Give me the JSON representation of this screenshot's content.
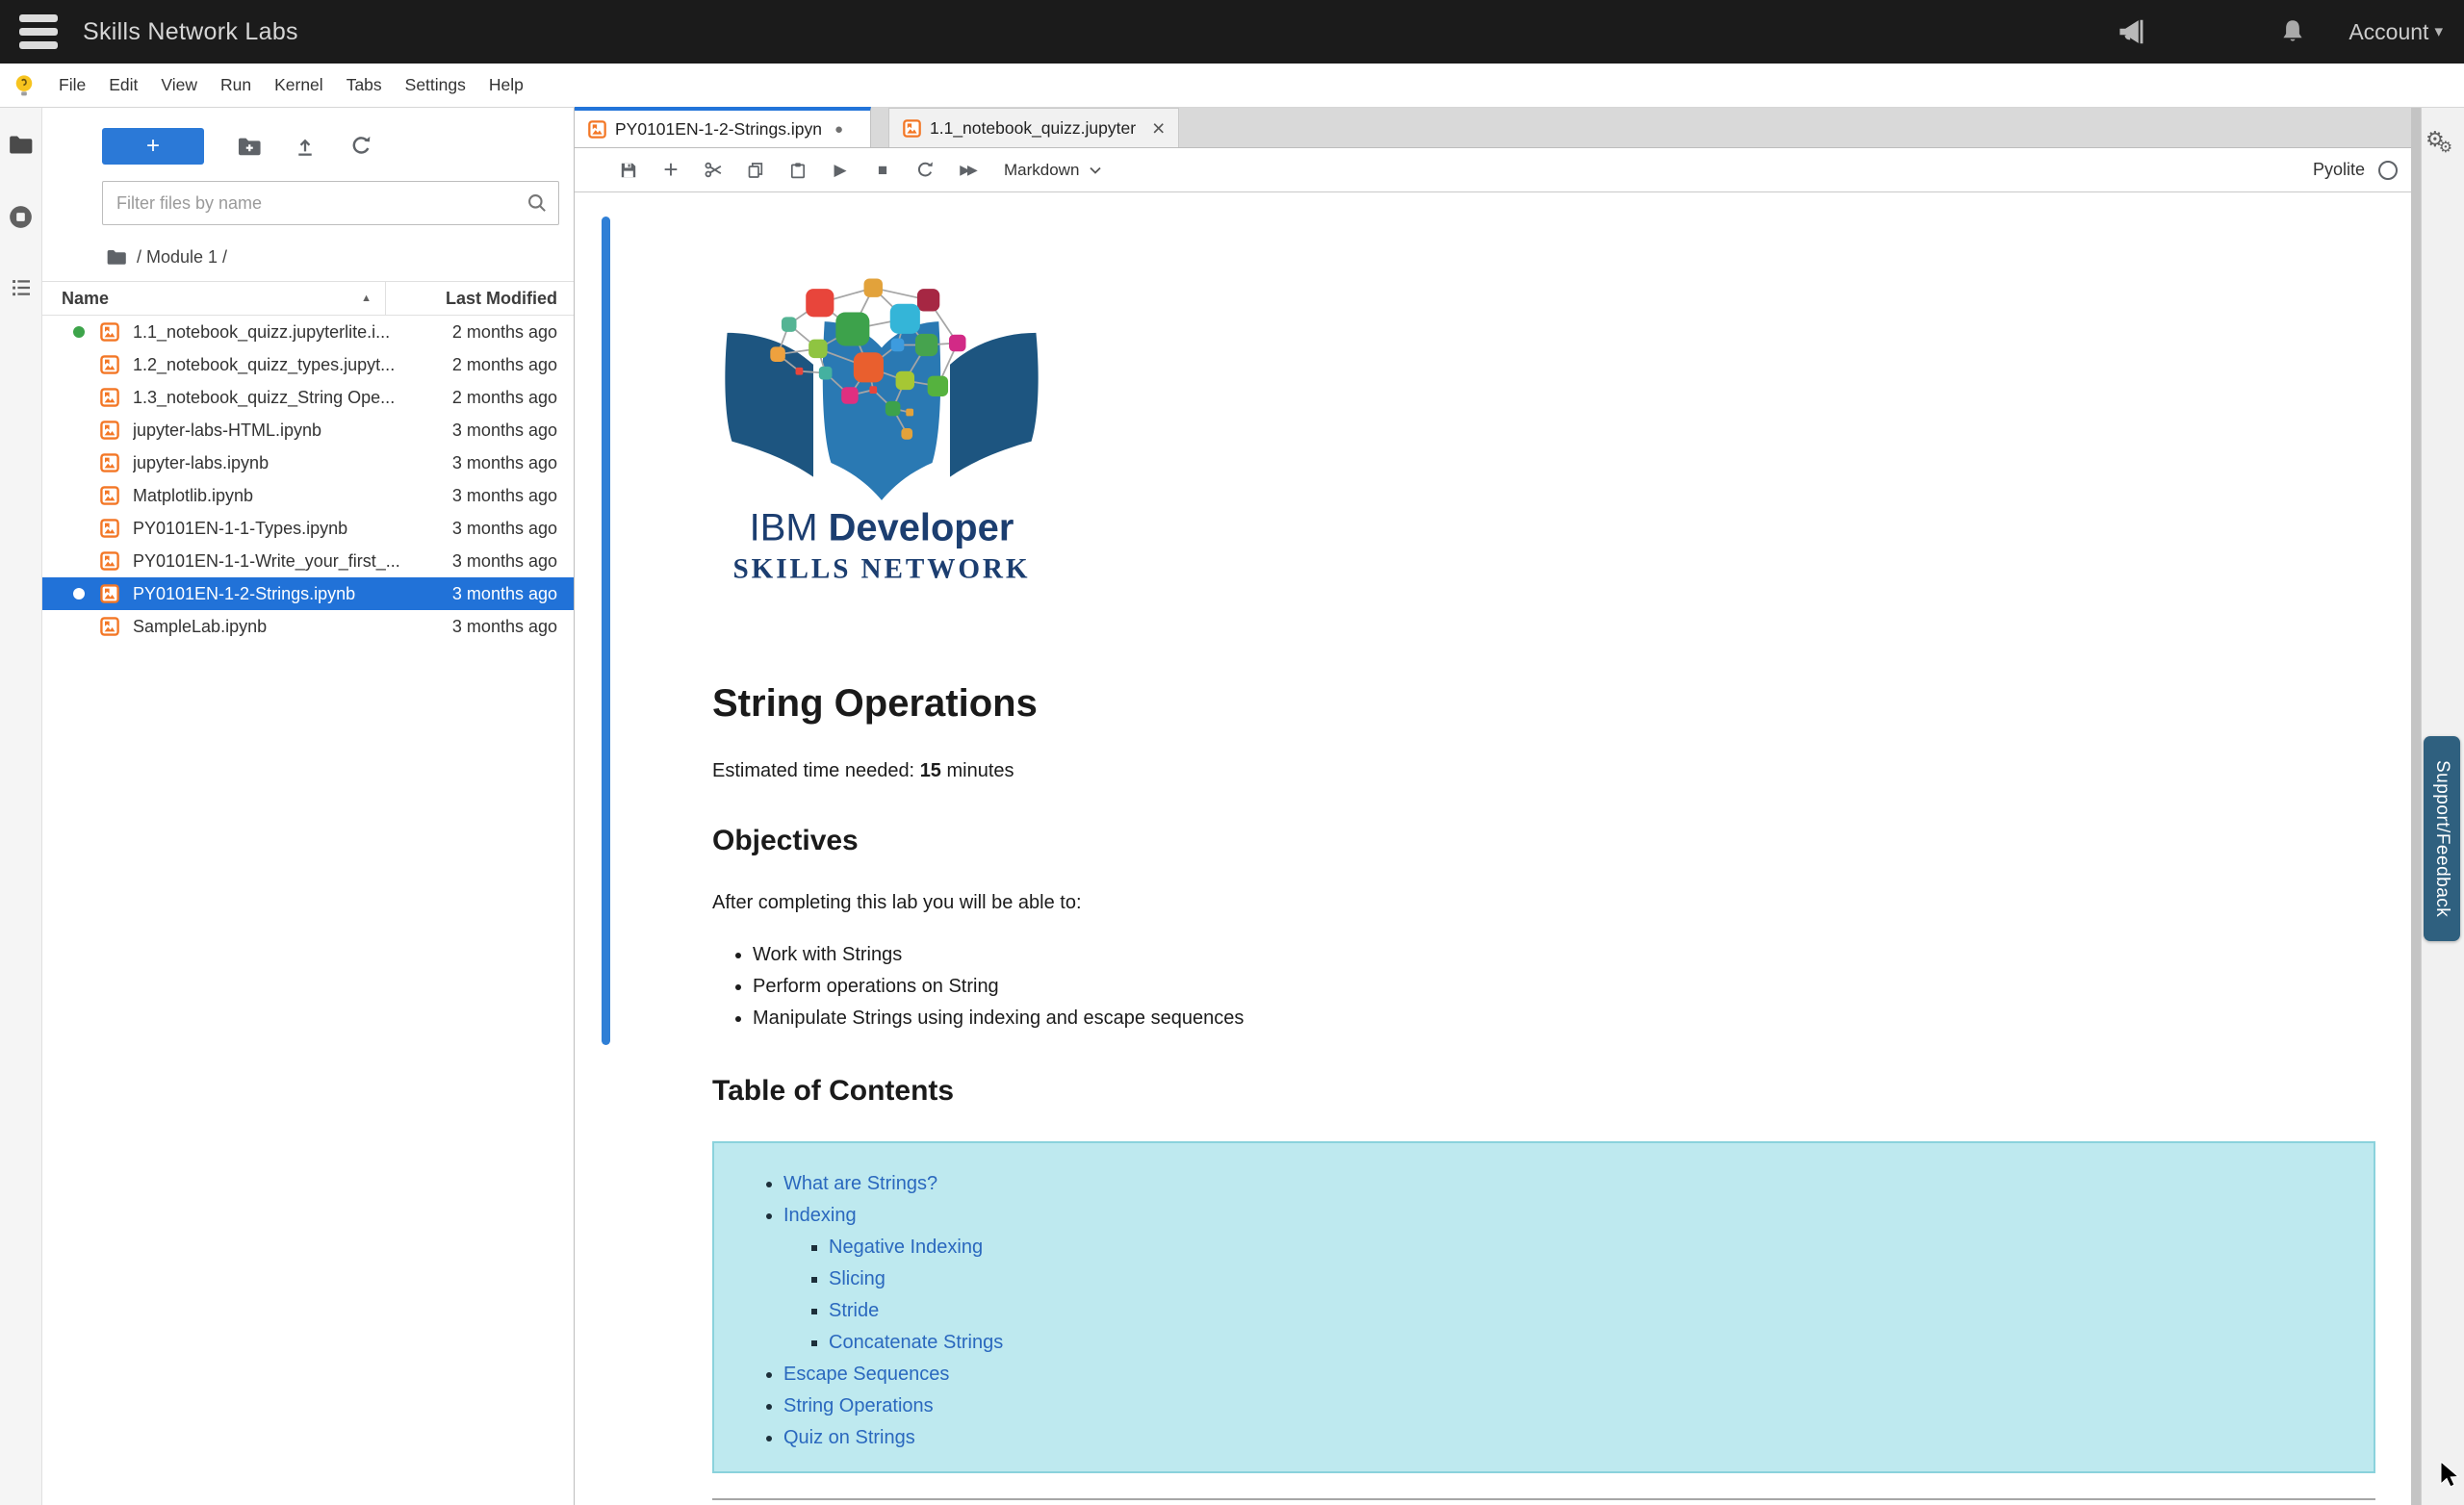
{
  "topbar": {
    "title": "Skills Network Labs",
    "account_label": "Account"
  },
  "menubar": {
    "items": [
      "File",
      "Edit",
      "View",
      "Run",
      "Kernel",
      "Tabs",
      "Settings",
      "Help"
    ]
  },
  "sidebar": {
    "new_launcher_label": "+",
    "filter_placeholder": "Filter files by name",
    "breadcrumb": "/ Module 1 /",
    "columns": {
      "name": "Name",
      "modified": "Last Modified"
    },
    "files": [
      {
        "name": "1.1_notebook_quizz.jupyterlite.i...",
        "modified": "2 months ago",
        "running": true,
        "selected": false
      },
      {
        "name": "1.2_notebook_quizz_types.jupyt...",
        "modified": "2 months ago",
        "running": false,
        "selected": false
      },
      {
        "name": "1.3_notebook_quizz_String Ope...",
        "modified": "2 months ago",
        "running": false,
        "selected": false
      },
      {
        "name": "jupyter-labs-HTML.ipynb",
        "modified": "3 months ago",
        "running": false,
        "selected": false
      },
      {
        "name": "jupyter-labs.ipynb",
        "modified": "3 months ago",
        "running": false,
        "selected": false
      },
      {
        "name": "Matplotlib.ipynb",
        "modified": "3 months ago",
        "running": false,
        "selected": false
      },
      {
        "name": "PY0101EN-1-1-Types.ipynb",
        "modified": "3 months ago",
        "running": false,
        "selected": false
      },
      {
        "name": "PY0101EN-1-1-Write_your_first_...",
        "modified": "3 months ago",
        "running": false,
        "selected": false
      },
      {
        "name": "PY0101EN-1-2-Strings.ipynb",
        "modified": "3 months ago",
        "running": true,
        "selected": true
      },
      {
        "name": "SampleLab.ipynb",
        "modified": "3 months ago",
        "running": false,
        "selected": false
      }
    ]
  },
  "main": {
    "tabs": [
      {
        "label": "PY0101EN-1-2-Strings.ipyn",
        "dirty": true,
        "active": true
      },
      {
        "label": "1.1_notebook_quizz.jupyter",
        "dirty": false,
        "active": false
      }
    ],
    "toolbar": {
      "cell_type": "Markdown",
      "kernel_name": "Pyolite"
    }
  },
  "notebook": {
    "logo": {
      "line1_regular": "IBM ",
      "line1_bold": "Developer",
      "line2": "SKILLS NETWORK"
    },
    "title": "String Operations",
    "estimated_prefix": "Estimated time needed: ",
    "estimated_value": "15",
    "estimated_suffix": " minutes",
    "objectives_heading": "Objectives",
    "objectives_intro": "After completing this lab you will be able to:",
    "objectives": [
      "Work with Strings",
      "Perform operations on String",
      "Manipulate Strings using indexing and escape sequences"
    ],
    "toc_heading": "Table of Contents",
    "toc": [
      {
        "label": "What are Strings?",
        "level": 1
      },
      {
        "label": "Indexing",
        "level": 1
      },
      {
        "label": "Negative Indexing",
        "level": 2
      },
      {
        "label": "Slicing",
        "level": 2
      },
      {
        "label": "Stride",
        "level": 2
      },
      {
        "label": "Concatenate Strings",
        "level": 2
      },
      {
        "label": "Escape Sequences",
        "level": 1
      },
      {
        "label": "String Operations",
        "level": 1
      },
      {
        "label": "Quiz on Strings",
        "level": 1
      }
    ]
  },
  "support_tab_label": "Support/Feedback",
  "icons": {
    "run": "▶",
    "run_all": "▶▶",
    "stop": "■",
    "dirty_dot": "●",
    "close_tab": "×",
    "sort_asc": "▲",
    "account_caret": "▾",
    "gear_large": "⚙",
    "gear_small": "⚙",
    "plus": "+"
  },
  "colors": {
    "topbar_bg": "#1b1b1b",
    "brand_blue": "#2b79d7",
    "selection_blue": "#2172d8",
    "jupyter_orange": "#f37726",
    "toc_bg": "#bee9ef",
    "toc_border": "#8ad2dc",
    "link_blue": "#2a68be",
    "support_tab": "#2f607f"
  }
}
